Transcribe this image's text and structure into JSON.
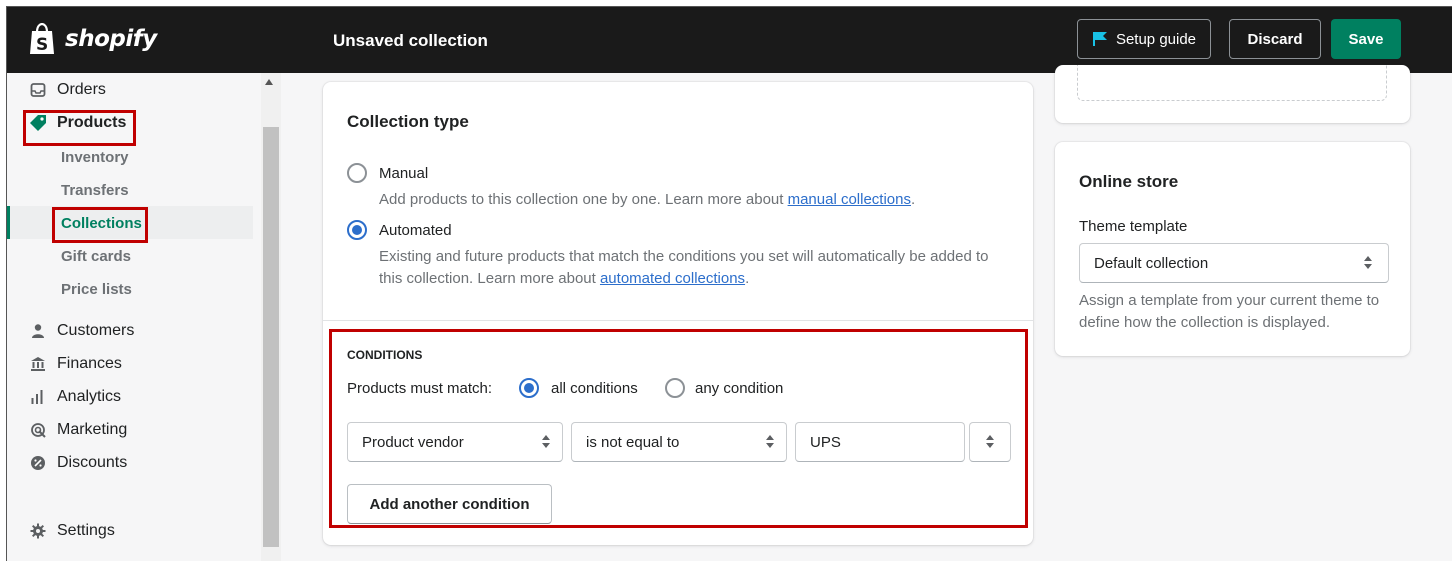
{
  "topbar": {
    "brand": "shopify",
    "title": "Unsaved collection",
    "setup_guide": "Setup guide",
    "discard": "Discard",
    "save": "Save"
  },
  "sidebar": {
    "orders": "Orders",
    "products": "Products",
    "inventory": "Inventory",
    "transfers": "Transfers",
    "collections": "Collections",
    "gift_cards": "Gift cards",
    "price_lists": "Price lists",
    "customers": "Customers",
    "finances": "Finances",
    "analytics": "Analytics",
    "marketing": "Marketing",
    "discounts": "Discounts",
    "settings": "Settings"
  },
  "collection_type": {
    "title": "Collection type",
    "manual_label": "Manual",
    "manual_help": "Add products to this collection one by one. Learn more about ",
    "manual_link": "manual collections",
    "automated_label": "Automated",
    "automated_help": "Existing and future products that match the conditions you set will automatically be added to this collection. Learn more about ",
    "automated_link": "automated collections",
    "selected": "Automated"
  },
  "conditions": {
    "title": "CONDITIONS",
    "match_label": "Products must match:",
    "all_label": "all conditions",
    "any_label": "any condition",
    "match_selected": "all conditions",
    "field": "Product vendor",
    "operator": "is not equal to",
    "value": "UPS",
    "add_button": "Add another condition"
  },
  "online_store": {
    "title": "Online store",
    "template_label": "Theme template",
    "template_value": "Default collection",
    "help": "Assign a template from your current theme to define how the collection is displayed."
  },
  "colors": {
    "topbar": "#1a1a1a",
    "save": "#008060",
    "link": "#2c6ecb",
    "highlight": "#c00000"
  }
}
